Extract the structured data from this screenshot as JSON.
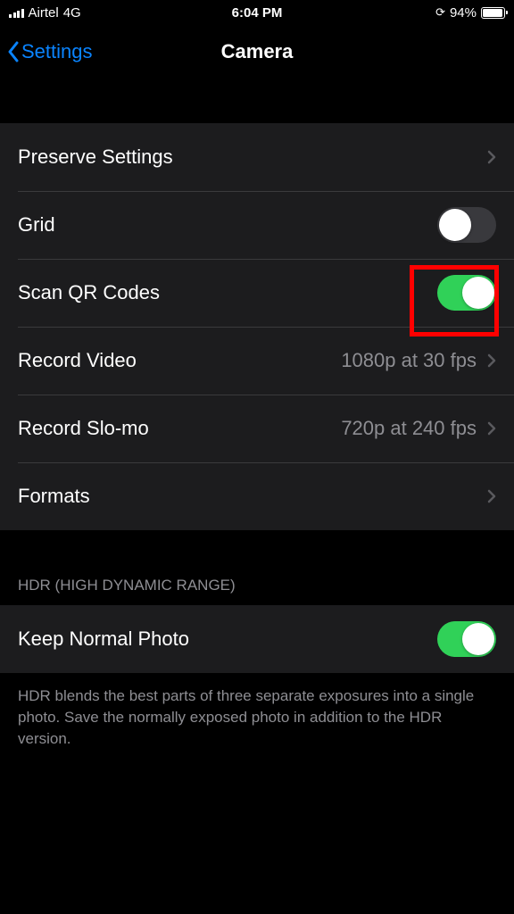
{
  "status": {
    "carrier": "Airtel",
    "network": "4G",
    "time": "6:04 PM",
    "battery_pct": "94%"
  },
  "nav": {
    "back_label": "Settings",
    "title": "Camera"
  },
  "section1": {
    "preserve": "Preserve Settings",
    "grid": "Grid",
    "scan_qr": "Scan QR Codes",
    "record_video": "Record Video",
    "record_video_value": "1080p at 30 fps",
    "record_slomo": "Record Slo-mo",
    "record_slomo_value": "720p at 240 fps",
    "formats": "Formats"
  },
  "section2": {
    "header": "HDR (HIGH DYNAMIC RANGE)",
    "keep_normal": "Keep Normal Photo",
    "footer": "HDR blends the best parts of three separate exposures into a single photo. Save the normally exposed photo in addition to the HDR version."
  },
  "toggles": {
    "grid": false,
    "scan_qr": true,
    "keep_normal": true
  }
}
